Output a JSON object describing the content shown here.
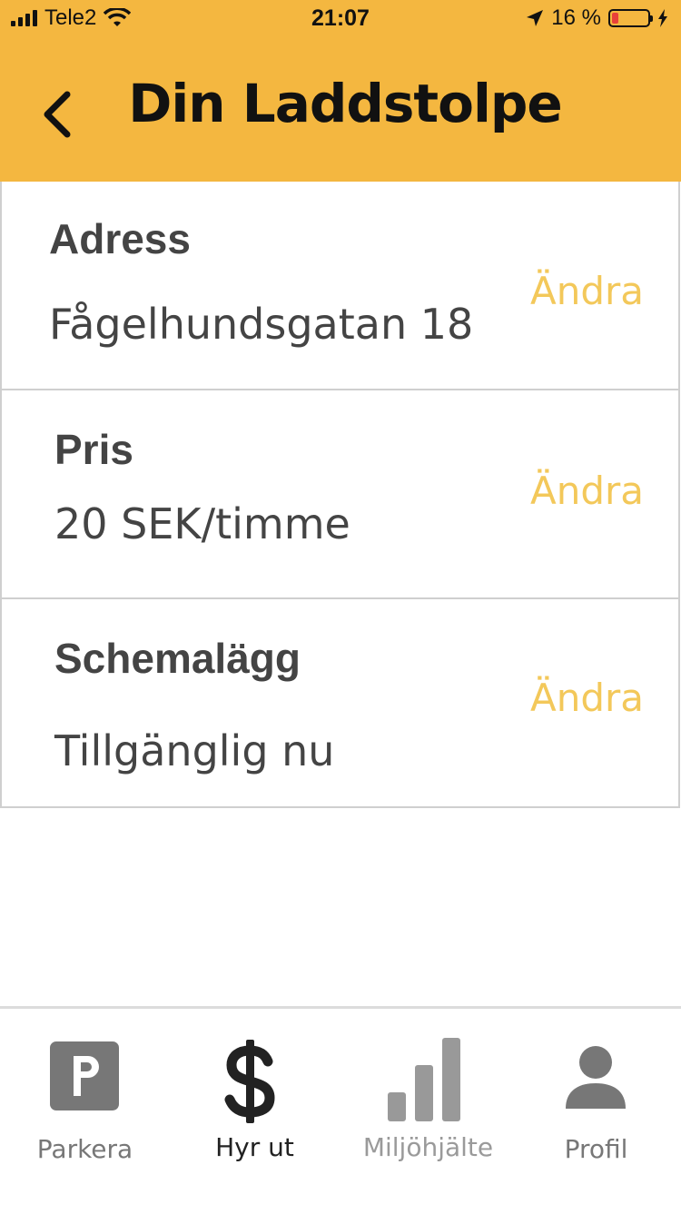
{
  "status_bar": {
    "carrier": "Tele2",
    "time": "21:07",
    "battery": "16 %",
    "battery_level": 0.16
  },
  "header": {
    "title": "Din Laddstolpe",
    "back_icon": "chevron-left-icon"
  },
  "rows": [
    {
      "title": "Adress",
      "value": "Fågelhundsgatan 18",
      "edit_label": "Ändra"
    },
    {
      "title": "Pris",
      "value": "20 SEK/timme",
      "edit_label": "Ändra"
    },
    {
      "title": "Schemalägg",
      "value": "Tillgänglig nu",
      "edit_label": "Ändra"
    }
  ],
  "tabs": [
    {
      "label": "Parkera",
      "icon": "parking-icon",
      "state": "inactive"
    },
    {
      "label": "Hyr ut",
      "icon": "dollar-icon",
      "state": "active"
    },
    {
      "label": "Miljöhjälte",
      "icon": "bar-chart-icon",
      "state": "disabled"
    },
    {
      "label": "Profil",
      "icon": "user-icon",
      "state": "inactive"
    }
  ],
  "colors": {
    "header_bg": "#F4B740",
    "accent": "#F3C85A",
    "text": "#444444",
    "tab_active": "#222222",
    "tab_inactive": "#777777",
    "tab_disabled": "#9a9a9a"
  }
}
